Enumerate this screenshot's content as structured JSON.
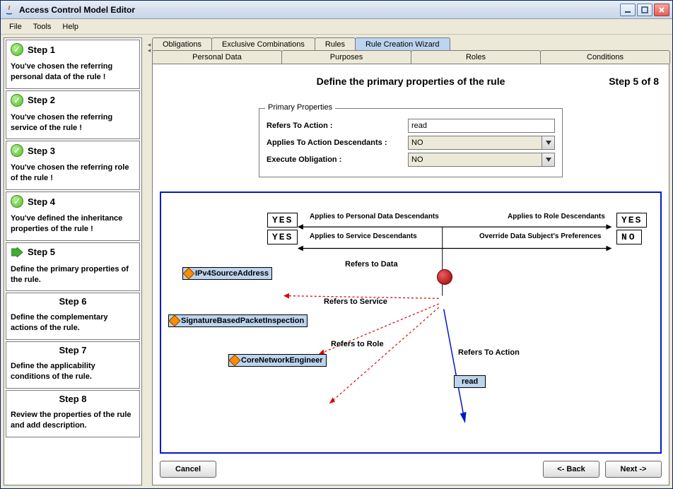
{
  "window": {
    "title": "Access Control Model Editor"
  },
  "menu": {
    "file": "File",
    "tools": "Tools",
    "help": "Help"
  },
  "steps": [
    {
      "title": "Step 1",
      "status": "done",
      "desc": "You've chosen the referring personal data of the rule !"
    },
    {
      "title": "Step 2",
      "status": "done",
      "desc": "You've chosen the referring service of the rule !"
    },
    {
      "title": "Step 3",
      "status": "done",
      "desc": "You've chosen the referring role of the rule !"
    },
    {
      "title": "Step 4",
      "status": "done",
      "desc": "You've defined the inheritance properties of the rule !"
    },
    {
      "title": "Step 5",
      "status": "current",
      "desc": "Define the primary properties of the rule."
    },
    {
      "title": "Step 6",
      "status": "future",
      "desc": "Define the complementary actions of the rule."
    },
    {
      "title": "Step 7",
      "status": "future",
      "desc": "Define the applicability conditions of the rule."
    },
    {
      "title": "Step 8",
      "status": "future",
      "desc": "Review the properties of the rule and add description."
    }
  ],
  "tabs_top": [
    {
      "label": "Obligations",
      "selected": false
    },
    {
      "label": "Exclusive Combinations",
      "selected": false
    },
    {
      "label": "Rules",
      "selected": false
    },
    {
      "label": "Rule Creation Wizard",
      "selected": true
    }
  ],
  "tabs_bottom": [
    {
      "label": "Personal Data"
    },
    {
      "label": "Purposes"
    },
    {
      "label": "Roles"
    },
    {
      "label": "Conditions"
    }
  ],
  "page": {
    "heading": "Define the primary properties of the rule",
    "step_indicator": "Step 5 of 8"
  },
  "properties": {
    "legend": "Primary Properties",
    "action_label": "Refers To Action :",
    "action_value": "read",
    "descendants_label": "Applies To Action Descendants :",
    "descendants_value": "NO",
    "obligation_label": "Execute Obligation :",
    "obligation_value": "NO"
  },
  "diagram": {
    "left_top": "YES",
    "left_bottom": "YES",
    "right_top": "YES",
    "right_bottom": "NO",
    "label_pd": "Applies to Personal Data Descendants",
    "label_sd": "Applies to Service Descendants",
    "label_rd": "Applies to Role Descendants",
    "label_ov": "Override Data Subject's Preferences",
    "node_data": "IPv4SourceAddress",
    "node_service": "SignatureBasedPacketInspection",
    "node_role": "CoreNetworkEngineer",
    "node_action": "read",
    "edge_data": "Refers to Data",
    "edge_service": "Refers to Service",
    "edge_role": "Refers to Role",
    "edge_action": "Refers To Action"
  },
  "buttons": {
    "cancel": "Cancel",
    "back": "<- Back",
    "next": "Next ->"
  }
}
